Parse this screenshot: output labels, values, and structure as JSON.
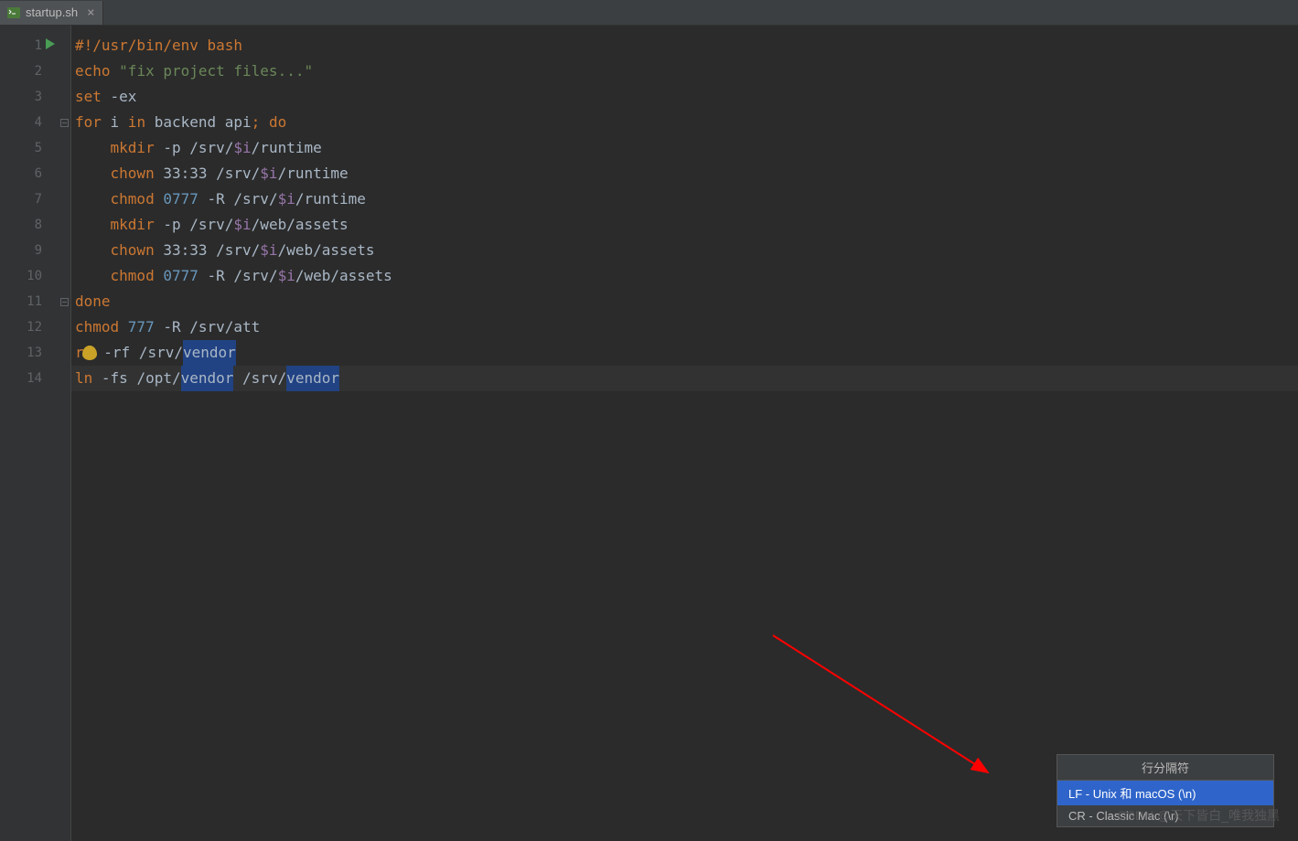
{
  "tab": {
    "filename": "startup.sh",
    "close_glyph": "×"
  },
  "lines": {
    "count": 14,
    "l1": {
      "shebang": "#!/usr/bin/env bash"
    },
    "l2": {
      "cmd": "echo ",
      "str": "\"fix project files...\""
    },
    "l3": {
      "cmd": "set ",
      "flags": "-ex"
    },
    "l4": {
      "kw1": "for ",
      "var": "i",
      "kw2": " in ",
      "list": "backend api",
      "kw3": "; do"
    },
    "l5": {
      "cmd": "    mkdir ",
      "flags": "-p ",
      "path1": "/srv/",
      "var": "$i",
      "path2": "/runtime"
    },
    "l6": {
      "cmd": "    chown ",
      "args": "33:33 ",
      "path1": "/srv/",
      "var": "$i",
      "path2": "/runtime"
    },
    "l7": {
      "cmd": "    chmod ",
      "num": "0777 ",
      "flags": "-R ",
      "path1": "/srv/",
      "var": "$i",
      "path2": "/runtime"
    },
    "l8": {
      "cmd": "    mkdir ",
      "flags": "-p ",
      "path1": "/srv/",
      "var": "$i",
      "path2": "/web/assets"
    },
    "l9": {
      "cmd": "    chown ",
      "args": "33:33 ",
      "path1": "/srv/",
      "var": "$i",
      "path2": "/web/assets"
    },
    "l10": {
      "cmd": "    chmod ",
      "num": "0777 ",
      "flags": "-R ",
      "path1": "/srv/",
      "var": "$i",
      "path2": "/web/assets"
    },
    "l11": {
      "kw": "done"
    },
    "l12": {
      "cmd": "chmod ",
      "num": "777 ",
      "flags": "-R ",
      "path": "/srv/att"
    },
    "l13": {
      "cmd_pre": "r",
      "cmd_post": " ",
      "flags": "-rf ",
      "path1": "/srv/",
      "hl": "vendor"
    },
    "l14": {
      "cmd": "ln ",
      "flags": "-fs ",
      "path1": "/opt/",
      "hl1": "vendor",
      "sp": " ",
      "path2": "/srv/",
      "hl2": "vendor"
    }
  },
  "popup": {
    "title": "行分隔符",
    "items": [
      {
        "label": "LF - Unix 和 macOS (\\n)",
        "selected": true
      },
      {
        "label": "CR - Classic Mac (\\r)",
        "selected": false
      }
    ]
  },
  "watermark": "CSDN @天下皆白_唯我独黑"
}
